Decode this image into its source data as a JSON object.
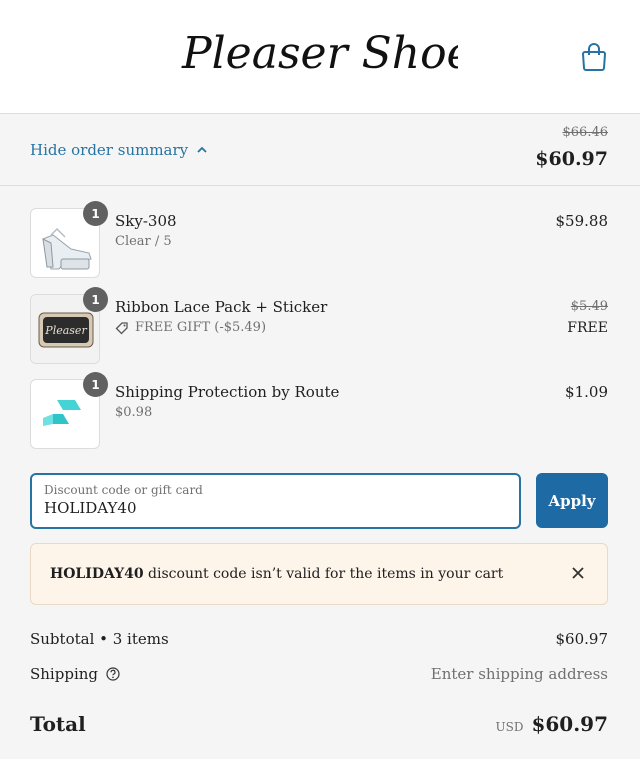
{
  "header": {
    "logo_text": "Pleaser Shoes"
  },
  "summary_toggle": {
    "label": "Hide order summary",
    "original_total": "$66.46",
    "total": "$60.97"
  },
  "line_items": [
    {
      "quantity": "1",
      "name": "Sky-308",
      "variant": "Clear / 5",
      "price": "$59.88"
    },
    {
      "quantity": "1",
      "name": "Ribbon Lace Pack + Sticker",
      "discount_label": "FREE GIFT (-$5.49)",
      "original_price": "$5.49",
      "price": "FREE",
      "thumb_text": "Pleaser"
    },
    {
      "quantity": "1",
      "name": "Shipping Protection by Route",
      "variant": "$0.98",
      "price": "$1.09"
    }
  ],
  "discount": {
    "label": "Discount code or gift card",
    "value": "HOLIDAY40",
    "apply_label": "Apply"
  },
  "error": {
    "code": "HOLIDAY40",
    "message": " discount code isn’t valid for the items in your cart"
  },
  "totals": {
    "subtotal_label": "Subtotal • 3 items",
    "subtotal_value": "$60.97",
    "shipping_label": "Shipping",
    "shipping_value": "Enter shipping address",
    "total_label": "Total",
    "currency": "USD",
    "total_value": "$60.97"
  },
  "colors": {
    "accent": "#2774a3",
    "button": "#1d6aa5",
    "error_bg": "#fdf4ea",
    "route_icon": "#2ec4c8"
  },
  "icons": [
    "cart-bag-icon",
    "chevron-up-icon",
    "tag-icon",
    "help-circle-icon",
    "close-icon"
  ]
}
